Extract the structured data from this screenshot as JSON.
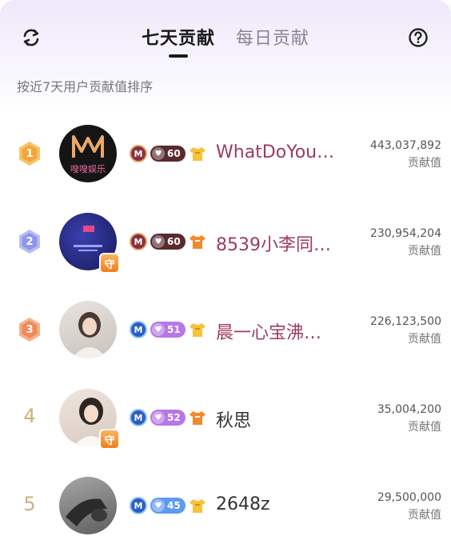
{
  "header": {
    "tabs": [
      {
        "label": "七天贡献",
        "active": true
      },
      {
        "label": "每日贡献",
        "active": false
      }
    ],
    "refresh_icon": "refresh-icon",
    "help_icon": "help-icon"
  },
  "subtitle": "按近7天用户贡献值排序",
  "rows": [
    {
      "rank": "1",
      "name": "WhatDoYou…",
      "level": "60",
      "score": "443,037,892",
      "score_label": "贡献值",
      "avatar_text": "嗖嗖娱乐"
    },
    {
      "rank": "2",
      "name": "8539小李同…",
      "level": "60",
      "score": "230,954,204",
      "score_label": "贡献值",
      "guard": "守"
    },
    {
      "rank": "3",
      "name": "晨一心宝沸…",
      "level": "51",
      "score": "226,123,500",
      "score_label": "贡献值"
    },
    {
      "rank": "4",
      "name": "秋思",
      "level": "52",
      "score": "35,004,200",
      "score_label": "贡献值",
      "guard": "守"
    },
    {
      "rank": "5",
      "name": "2648z",
      "level": "45",
      "score": "29,500,000",
      "score_label": "贡献值"
    }
  ],
  "colors": {
    "gold": "#f5b24a",
    "silver": "#8f95e8",
    "bronze": "#ef8a5a",
    "name_red": "#9c3b5e"
  }
}
